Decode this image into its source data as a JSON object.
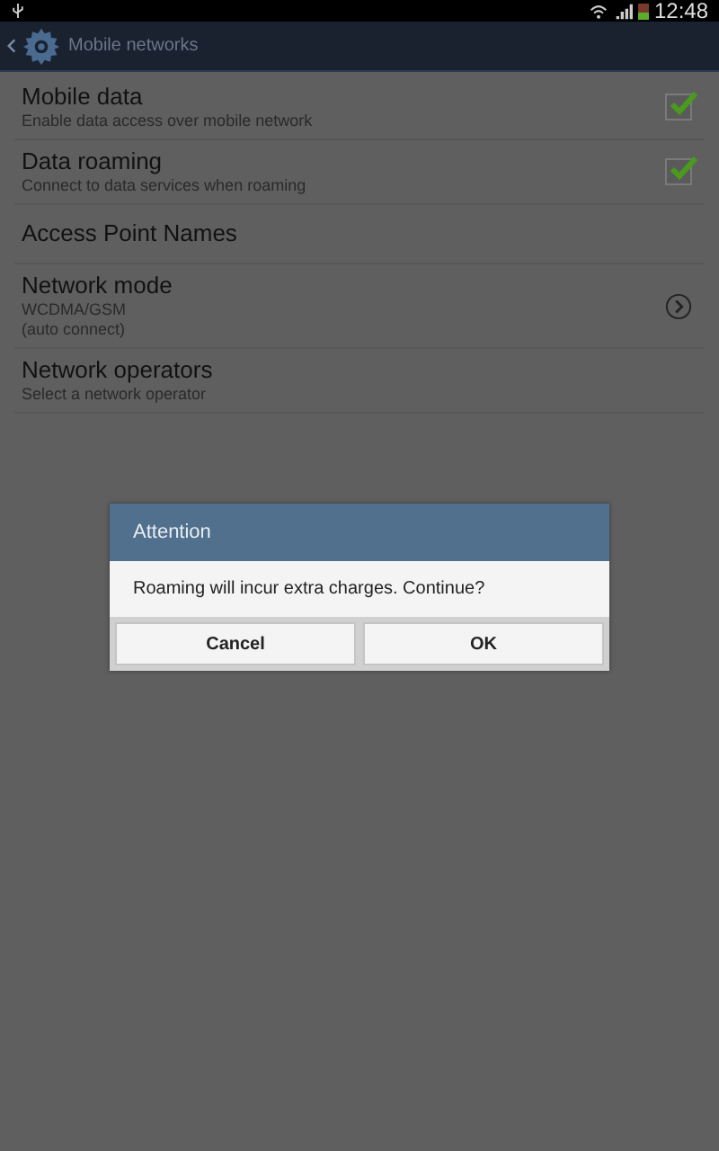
{
  "status_bar": {
    "time": "12:48"
  },
  "action_bar": {
    "title": "Mobile networks"
  },
  "settings": [
    {
      "kind": "checkbox",
      "title": "Mobile data",
      "summary": [
        "Enable data access over mobile network"
      ],
      "checked": true
    },
    {
      "kind": "checkbox",
      "title": "Data roaming",
      "summary": [
        "Connect to data services when roaming"
      ],
      "checked": true
    },
    {
      "kind": "plain",
      "title": "Access Point Names"
    },
    {
      "kind": "arrow",
      "title": "Network mode",
      "summary": [
        "WCDMA/GSM",
        "(auto connect)"
      ]
    },
    {
      "kind": "plain",
      "title": "Network operators",
      "summary": [
        "Select a network operator"
      ]
    }
  ],
  "dialog": {
    "title": "Attention",
    "message": "Roaming will incur extra charges. Continue?",
    "buttons": [
      "Cancel",
      "OK"
    ]
  }
}
